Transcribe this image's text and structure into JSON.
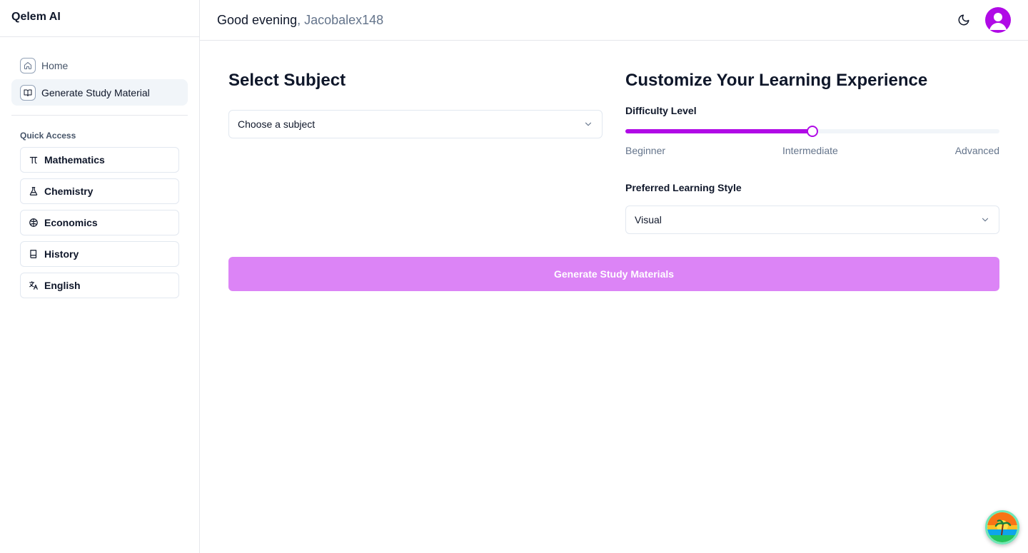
{
  "app": {
    "name": "Qelem AI"
  },
  "sidebar": {
    "nav": [
      {
        "label": "Home",
        "icon": "home-icon"
      },
      {
        "label": "Generate Study Material",
        "icon": "book-open-icon"
      }
    ],
    "quick_access_title": "Quick Access",
    "quick_access": [
      {
        "label": "Mathematics",
        "icon": "pi-icon"
      },
      {
        "label": "Chemistry",
        "icon": "flask-icon"
      },
      {
        "label": "Economics",
        "icon": "globe-icon"
      },
      {
        "label": "History",
        "icon": "book-icon"
      },
      {
        "label": "English",
        "icon": "translate-icon"
      }
    ]
  },
  "header": {
    "greeting": "Good evening",
    "username": ", Jacobalex148"
  },
  "subject": {
    "title": "Select Subject",
    "select_value": "Choose a subject"
  },
  "customize": {
    "title": "Customize Your Learning Experience",
    "difficulty_label": "Difficulty Level",
    "difficulty_value": 0.5,
    "difficulty_ticks": [
      "Beginner",
      "Intermediate",
      "Advanced"
    ],
    "style_label": "Preferred Learning Style",
    "style_value": "Visual"
  },
  "actions": {
    "generate_label": "Generate Study Materials"
  },
  "colors": {
    "accent": "#b00ae6",
    "button_disabled": "#dc84f6"
  }
}
